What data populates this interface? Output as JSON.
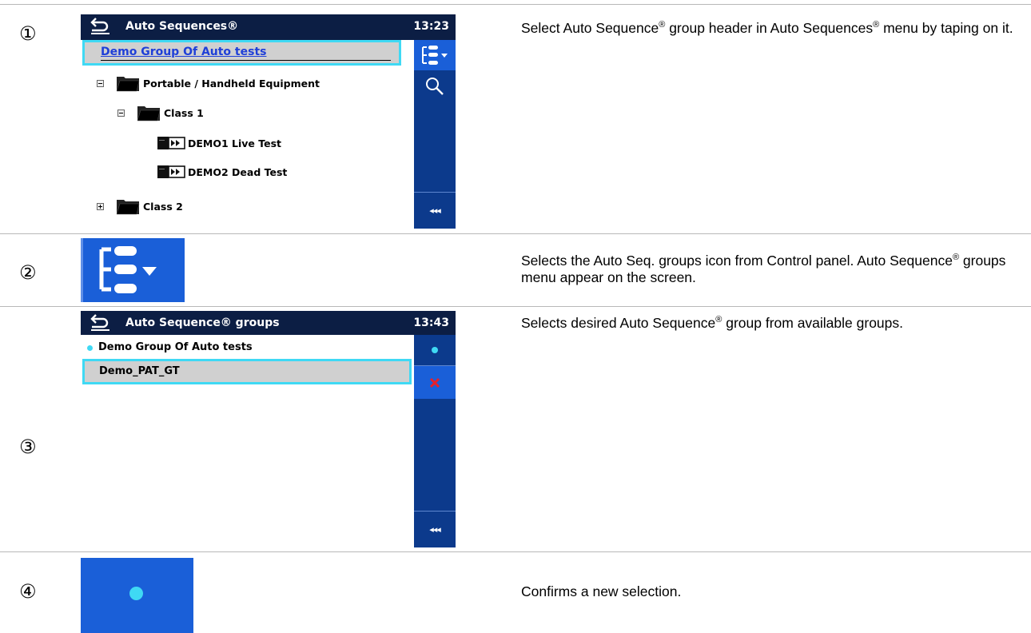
{
  "steps": [
    {
      "number": "①",
      "screen": {
        "title": "Auto Sequences®",
        "time": "13:23",
        "selected_header": "Demo Group Of Auto tests",
        "tree": [
          {
            "label": "Portable / Handheld Equipment",
            "expander": "minus",
            "type": "folder"
          },
          {
            "label": "Class 1",
            "expander": "minus",
            "type": "folder"
          },
          {
            "label": "DEMO1 Live Test",
            "type": "sequence"
          },
          {
            "label": "DEMO2 Dead Test",
            "type": "sequence"
          },
          {
            "label": "Class 2",
            "expander": "plus",
            "type": "folder"
          }
        ],
        "side_buttons": [
          "tree-groups-icon",
          "search-icon"
        ],
        "collapse_label": "◂◂◂"
      },
      "desc_before": "Select Auto Sequence",
      "desc_sup": "®",
      "desc_after": " group header in Auto Sequences",
      "desc_sup2": "®",
      "desc_after2": " menu by taping on it."
    },
    {
      "number": "②",
      "icon": "tree-groups-icon",
      "desc_before": "Selects the Auto Seq. groups icon from Control panel. Auto Sequence",
      "desc_sup": "®",
      "desc_after": " groups menu appear on the screen."
    },
    {
      "number": "③",
      "screen": {
        "title": "Auto Sequence® groups",
        "time": "13:43",
        "groups": [
          {
            "label": "Demo Group Of Auto tests",
            "active": true
          },
          {
            "label": "Demo_PAT_GT",
            "active": false
          }
        ],
        "side_buttons": [
          "dot-icon",
          "delete-icon"
        ],
        "collapse_label": "◂◂◂"
      },
      "desc_before": "Selects desired Auto Sequence",
      "desc_sup": "®",
      "desc_after": " group from available groups."
    },
    {
      "number": "④",
      "icon": "dot-icon",
      "desc": "Confirms a new selection."
    }
  ],
  "colors": {
    "title_bar": "#0c1e44",
    "side_panel": "#0c3a8c",
    "button_blue": "#1a5fd8",
    "highlight_border": "#3fd9f4",
    "link_blue": "#1f3fd8",
    "delete_red": "#e8202a"
  }
}
